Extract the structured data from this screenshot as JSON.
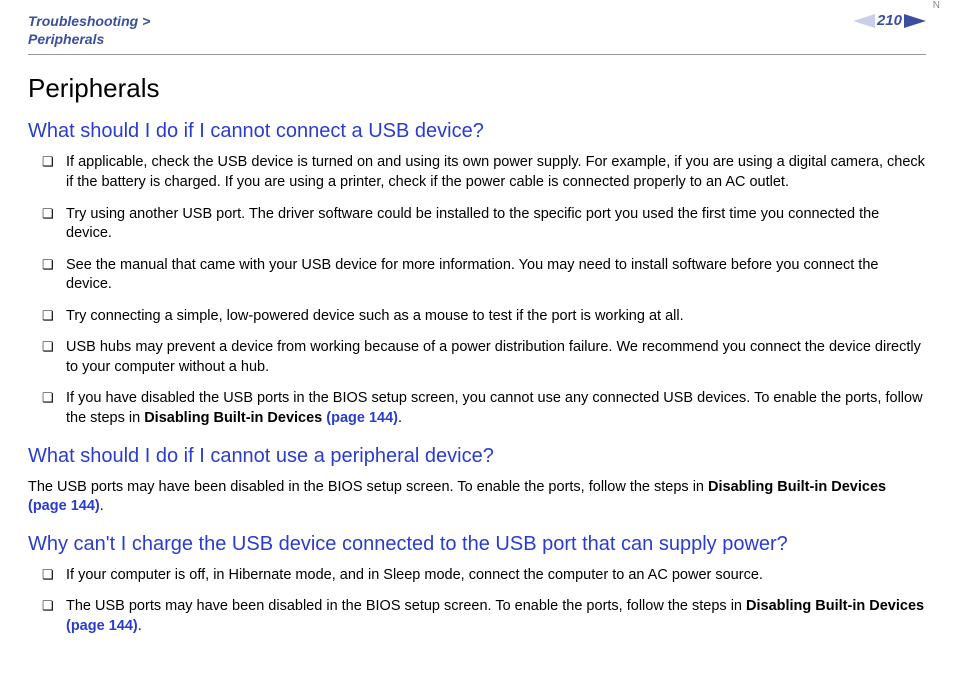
{
  "header": {
    "breadcrumb_parent": "Troubleshooting >",
    "breadcrumb_current": "Peripherals",
    "page_number": "210",
    "nav_label": "N"
  },
  "title": "Peripherals",
  "sections": [
    {
      "heading": "What should I do if I cannot connect a USB device?",
      "bullets": [
        {
          "pre": "If applicable, check the USB device is turned on and using its own power supply. For example, if you are using a digital camera, check if the battery is charged. If you are using a printer, check if the power cable is connected properly to an AC outlet."
        },
        {
          "pre": "Try using another USB port. The driver software could be installed to the specific port you used the first time you connected the device."
        },
        {
          "pre": "See the manual that came with your USB device for more information. You may need to install software before you connect the device."
        },
        {
          "pre": "Try connecting a simple, low-powered device such as a mouse to test if the port is working at all."
        },
        {
          "pre": "USB hubs may prevent a device from working because of a power distribution failure. We recommend you connect the device directly to your computer without a hub."
        },
        {
          "pre": "If you have disabled the USB ports in the BIOS setup screen, you cannot use any connected USB devices. To enable the ports, follow the steps in ",
          "bold": "Disabling Built-in Devices ",
          "link": "(page 144)",
          "post": "."
        }
      ]
    },
    {
      "heading": "What should I do if I cannot use a peripheral device?",
      "paragraph": {
        "pre": "The USB ports may have been disabled in the BIOS setup screen. To enable the ports, follow the steps in ",
        "bold": "Disabling Built-in Devices ",
        "link": "(page 144)",
        "post": "."
      }
    },
    {
      "heading": "Why can't I charge the USB device connected to the USB port that can supply power?",
      "bullets": [
        {
          "pre": "If your computer is off, in Hibernate mode, and in Sleep mode, connect the computer to an AC power source."
        },
        {
          "pre": "The USB ports may have been disabled in the BIOS setup screen. To enable the ports, follow the steps in ",
          "bold": "Disabling Built-in Devices ",
          "link": "(page 144)",
          "post": "."
        }
      ]
    }
  ]
}
